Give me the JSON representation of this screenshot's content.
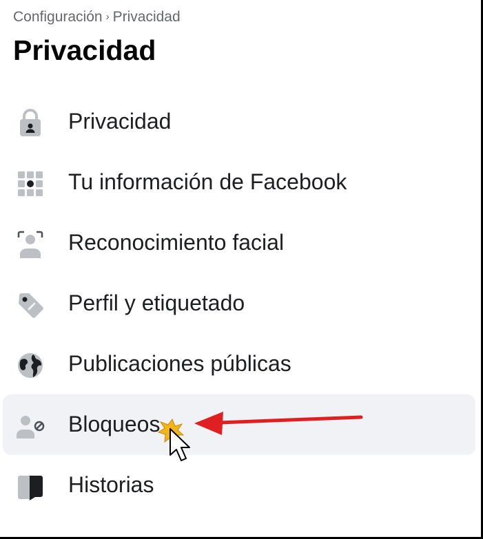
{
  "breadcrumb": {
    "parent": "Configuración",
    "separator": "›",
    "current": "Privacidad"
  },
  "page_title": "Privacidad",
  "menu": {
    "items": [
      {
        "label": "Privacidad",
        "icon": "lock-icon"
      },
      {
        "label": "Tu información de Facebook",
        "icon": "grid-info-icon"
      },
      {
        "label": "Reconocimiento facial",
        "icon": "face-scan-icon"
      },
      {
        "label": "Perfil y etiquetado",
        "icon": "tag-icon"
      },
      {
        "label": "Publicaciones públicas",
        "icon": "globe-icon"
      },
      {
        "label": "Bloqueos",
        "icon": "person-blocked-icon",
        "active": true
      },
      {
        "label": "Historias",
        "icon": "book-icon"
      }
    ]
  },
  "annotation": {
    "arrow_color": "#e02020",
    "target": "Bloqueos"
  },
  "colors": {
    "icon_fill": "#bcc0c4",
    "icon_dark": "#4b4f56",
    "active_bg": "#f0f2f5",
    "breadcrumb_text": "#65676b"
  }
}
